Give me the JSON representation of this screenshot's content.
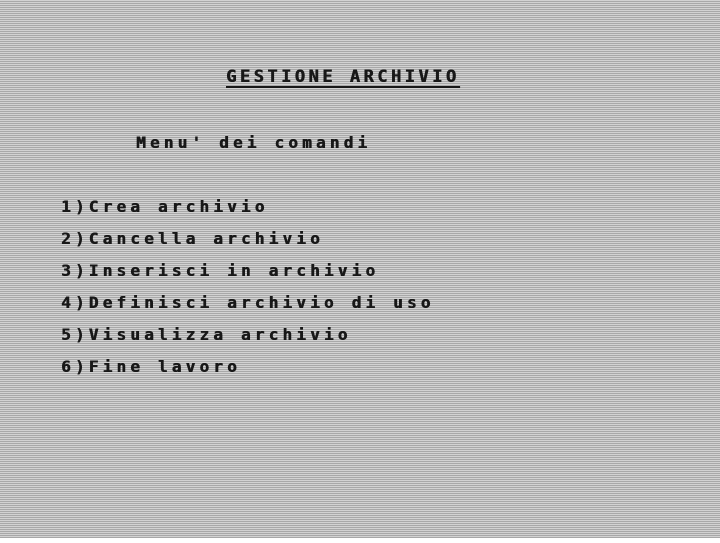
{
  "screen": {
    "title": "GESTIONE ARCHIVIO",
    "subtitle": "Menu' dei comandi",
    "menu_items": [
      {
        "label": "1)Crea archivio"
      },
      {
        "label": "2)Cancella archivio"
      },
      {
        "label": "3)Inserisci in archivio"
      },
      {
        "label": "4)Definisci archivio di uso"
      },
      {
        "label": "5)Visualizza archivio"
      },
      {
        "label": "6)Fine lavoro"
      }
    ]
  },
  "colors": {
    "background": "#c6c6c6",
    "text": "#181818"
  }
}
